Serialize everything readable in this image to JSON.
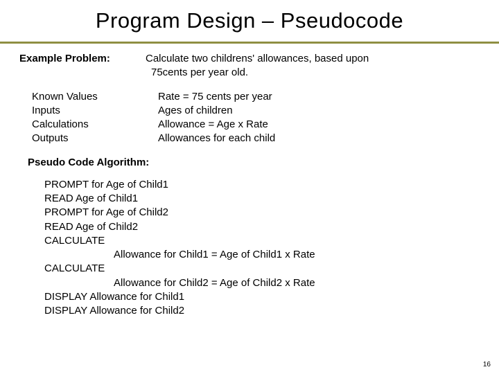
{
  "title": "Program Design – Pseudocode",
  "example_label": "Example Problem:",
  "example_desc_l1": "Calculate two childrens' allowances, based upon",
  "example_desc_l2": "75cents per year old.",
  "known": {
    "r1_label": "Known Values",
    "r1_val": "Rate = 75 cents per year",
    "r2_label": "Inputs",
    "r2_val": "Ages of children",
    "r3_label": "Calculations",
    "r3_val": "Allowance = Age x Rate",
    "r4_label": "Outputs",
    "r4_val": "Allowances for each child"
  },
  "algo_heading": "Pseudo Code Algorithm:",
  "algo": {
    "l1": "PROMPT for Age of Child1",
    "l2": "READ Age of Child1",
    "l3": "PROMPT for Age of Child2",
    "l4": "READ Age of Child2",
    "l5": "CALCULATE",
    "l6": "Allowance for Child1 = Age of Child1 x Rate",
    "l7": "CALCULATE",
    "l8": "Allowance for Child2 = Age of Child2 x Rate",
    "l9": "DISPLAY Allowance for Child1",
    "l10": "DISPLAY Allowance for Child2"
  },
  "page_number": "16"
}
